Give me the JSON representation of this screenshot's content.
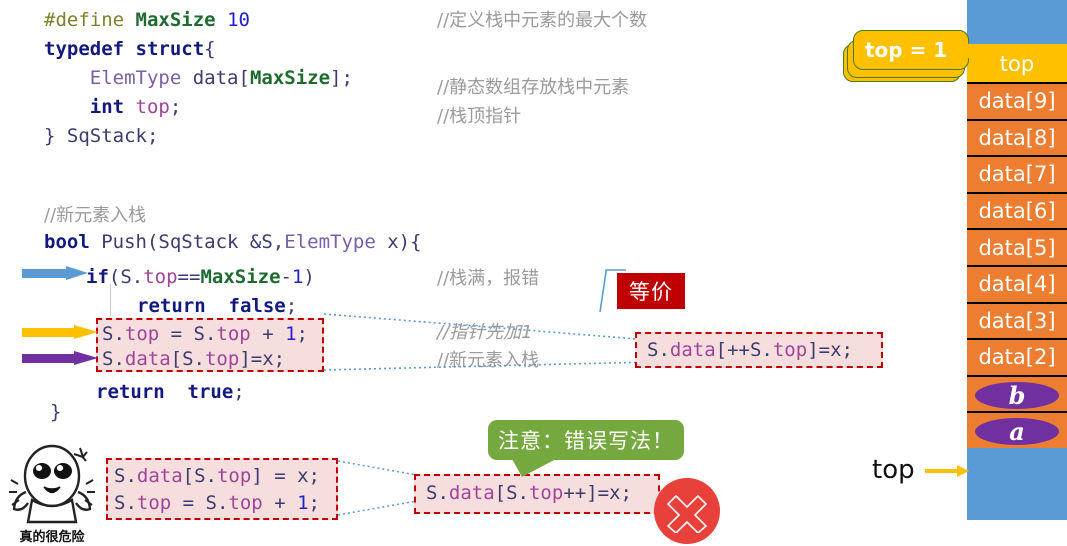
{
  "code_main": {
    "lines": [
      {
        "id": "l1",
        "tokens": [
          {
            "t": "#define",
            "c": "macro"
          },
          {
            "t": " ",
            "c": "plain"
          },
          {
            "t": "MaxSize",
            "c": "const"
          },
          {
            "t": " ",
            "c": "plain"
          },
          {
            "t": "10",
            "c": "num"
          }
        ]
      },
      {
        "id": "l2",
        "tokens": [
          {
            "t": "typedef struct",
            "c": "kw"
          },
          {
            "t": "{",
            "c": "plain"
          }
        ]
      },
      {
        "id": "l3",
        "tokens": [
          {
            "t": "    ",
            "c": "plain"
          },
          {
            "t": "ElemType",
            "c": "type"
          },
          {
            "t": " data",
            "c": "ident"
          },
          {
            "t": "[",
            "c": "plain"
          },
          {
            "t": "MaxSize",
            "c": "const"
          },
          {
            "t": "];",
            "c": "plain"
          }
        ]
      },
      {
        "id": "l4",
        "tokens": [
          {
            "t": "    ",
            "c": "plain"
          },
          {
            "t": "int",
            "c": "kw"
          },
          {
            "t": " ",
            "c": "plain"
          },
          {
            "t": "top",
            "c": "member"
          },
          {
            "t": ";",
            "c": "plain"
          }
        ]
      },
      {
        "id": "l5",
        "tokens": [
          {
            "t": "} SqStack;",
            "c": "ident"
          }
        ]
      }
    ]
  },
  "comments_struct": [
    {
      "id": "c1",
      "text": "//定义栈中元素的最大个数"
    },
    {
      "id": "c2",
      "text": "//静态数组存放栈中元素"
    },
    {
      "id": "c3",
      "text": "//栈顶指针"
    }
  ],
  "code_push": {
    "comment_header": "//新元素入栈",
    "signature": [
      {
        "t": "bool",
        "c": "kw"
      },
      {
        "t": " Push(",
        "c": "ident"
      },
      {
        "t": "SqStack",
        "c": "ident"
      },
      {
        "t": " &S,",
        "c": "ident"
      },
      {
        "t": "ElemType",
        "c": "type"
      },
      {
        "t": " x){",
        "c": "ident"
      }
    ],
    "line_if": [
      {
        "t": "if",
        "c": "kw"
      },
      {
        "t": "(S.",
        "c": "ident"
      },
      {
        "t": "top",
        "c": "member"
      },
      {
        "t": "==",
        "c": "plain"
      },
      {
        "t": "MaxSize",
        "c": "const"
      },
      {
        "t": "-",
        "c": "plain"
      },
      {
        "t": "1",
        "c": "num"
      },
      {
        "t": ")",
        "c": "plain"
      }
    ],
    "line_return_false": [
      {
        "t": "return  false",
        "c": "kw"
      },
      {
        "t": ";",
        "c": "plain"
      }
    ],
    "line_inc": [
      {
        "t": "S.",
        "c": "ident"
      },
      {
        "t": "top",
        "c": "member"
      },
      {
        "t": " = S.",
        "c": "ident"
      },
      {
        "t": "top",
        "c": "member"
      },
      {
        "t": " + ",
        "c": "ident"
      },
      {
        "t": "1",
        "c": "num"
      },
      {
        "t": ";",
        "c": "plain"
      }
    ],
    "line_assign": [
      {
        "t": "S.",
        "c": "ident"
      },
      {
        "t": "data",
        "c": "member"
      },
      {
        "t": "[S.",
        "c": "ident"
      },
      {
        "t": "top",
        "c": "member"
      },
      {
        "t": "]=x;",
        "c": "ident"
      }
    ],
    "line_return_true": [
      {
        "t": "return  true",
        "c": "kw"
      },
      {
        "t": ";",
        "c": "plain"
      }
    ],
    "line_close": [
      {
        "t": "}",
        "c": "ident"
      }
    ]
  },
  "comments_push": [
    {
      "id": "p1",
      "text": "//栈满，报错",
      "italic": false
    },
    {
      "id": "p2",
      "text": "//指针先加1",
      "italic": true
    },
    {
      "id": "p3",
      "text": "//新元素入栈",
      "italic": false
    }
  ],
  "equivalent": {
    "tag_label": "等价",
    "tag_color": "#c00000",
    "code": [
      {
        "t": "S.",
        "c": "ident"
      },
      {
        "t": "data",
        "c": "member"
      },
      {
        "t": "[++S.",
        "c": "ident"
      },
      {
        "t": "top",
        "c": "member"
      },
      {
        "t": "]=x;",
        "c": "ident"
      }
    ]
  },
  "wrong_example": {
    "callout_label": "注意：错误写法！",
    "callout_color": "#76a840",
    "left_code": [
      [
        {
          "t": "S.",
          "c": "ident"
        },
        {
          "t": "data",
          "c": "member"
        },
        {
          "t": "[S.",
          "c": "ident"
        },
        {
          "t": "top",
          "c": "member"
        },
        {
          "t": "] = x;",
          "c": "ident"
        }
      ],
      [
        {
          "t": "S.",
          "c": "ident"
        },
        {
          "t": "top",
          "c": "member"
        },
        {
          "t": " = S.",
          "c": "ident"
        },
        {
          "t": "top",
          "c": "member"
        },
        {
          "t": " + ",
          "c": "ident"
        },
        {
          "t": "1",
          "c": "num"
        },
        {
          "t": ";",
          "c": "plain"
        }
      ]
    ],
    "right_code": [
      {
        "t": "S.",
        "c": "ident"
      },
      {
        "t": "data",
        "c": "member"
      },
      {
        "t": "[S.",
        "c": "ident"
      },
      {
        "t": "top",
        "c": "member"
      },
      {
        "t": "++]=x;",
        "c": "ident"
      }
    ],
    "badge_icon": "cross-icon",
    "badge_color": "#e8413c"
  },
  "meme": {
    "caption": "真的很危险",
    "icon": "shocked-face-icon"
  },
  "stack_diagram": {
    "callout": {
      "label": "top = 1",
      "color": "#ffc000"
    },
    "pointer_label": "top",
    "pointer_arrow_color": "#ffc000",
    "top_cell": {
      "label": "top",
      "color": "#ffc000"
    },
    "cells": [
      {
        "label": "data[9]",
        "color": "#ed7d31",
        "type": "text"
      },
      {
        "label": "data[8]",
        "color": "#ed7d31",
        "type": "text"
      },
      {
        "label": "data[7]",
        "color": "#ed7d31",
        "type": "text"
      },
      {
        "label": "data[6]",
        "color": "#ed7d31",
        "type": "text"
      },
      {
        "label": "data[5]",
        "color": "#ed7d31",
        "type": "text"
      },
      {
        "label": "data[4]",
        "color": "#ed7d31",
        "type": "text"
      },
      {
        "label": "data[3]",
        "color": "#ed7d31",
        "type": "text"
      },
      {
        "label": "data[2]",
        "color": "#ed7d31",
        "type": "text"
      },
      {
        "label": "b",
        "color": "#ed7d31",
        "type": "ellipse",
        "ellipse_color": "#7030a0"
      },
      {
        "label": "a",
        "color": "#ed7d31",
        "type": "ellipse",
        "ellipse_color": "#7030a0"
      }
    ],
    "empty_color": "#5b9bd5"
  },
  "arrows": [
    {
      "id": "a-if",
      "color": "#5b9bd5",
      "name": "blue-arrow"
    },
    {
      "id": "a-inc",
      "color": "#ffc000",
      "name": "yellow-arrow"
    },
    {
      "id": "a-assign",
      "color": "#7030a0",
      "name": "purple-arrow"
    }
  ]
}
